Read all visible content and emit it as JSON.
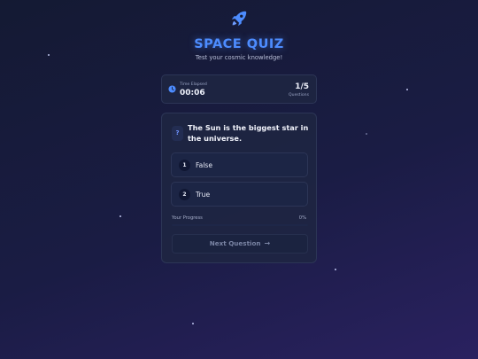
{
  "header": {
    "title": "SPACE QUIZ",
    "subtitle": "Test your cosmic knowledge!"
  },
  "timer": {
    "label": "Time Elapsed",
    "value": "00:06",
    "question_count": "1/5",
    "question_label": "Questions"
  },
  "quiz": {
    "question_icon": "?",
    "question": "The Sun is the biggest star in the universe.",
    "options": [
      {
        "number": "1",
        "label": "False"
      },
      {
        "number": "2",
        "label": "True"
      }
    ],
    "progress_label": "Your Progress",
    "progress_text": "0%",
    "progress_fraction": 0,
    "next_label": "Next Question",
    "next_icon": "→"
  },
  "colors": {
    "accent": "#4d8cff",
    "background_start": "#141a33",
    "background_end": "#2a2160",
    "card": "#1e2642"
  },
  "icons": {
    "logo": "rocket-icon",
    "timer": "clock-icon",
    "next": "arrow-right-icon"
  }
}
